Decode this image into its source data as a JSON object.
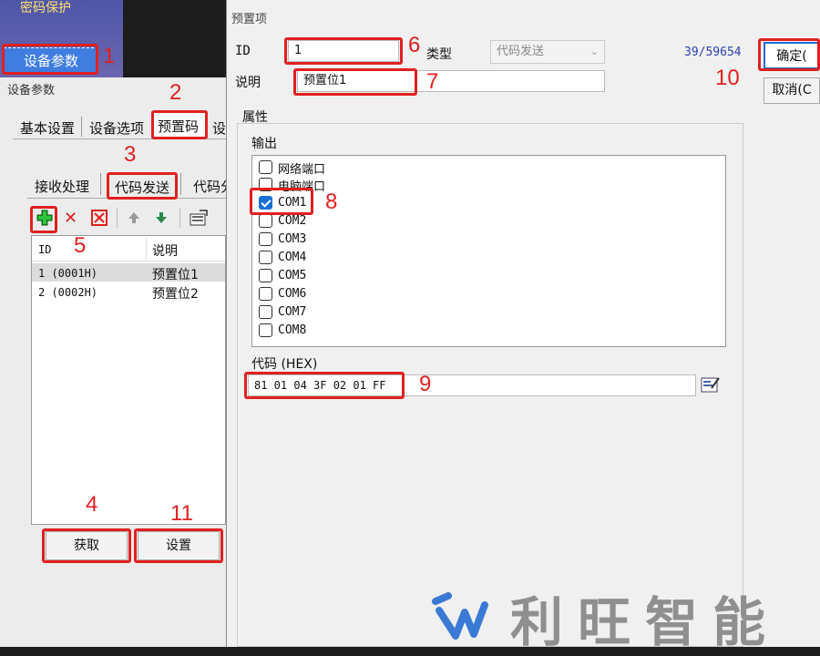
{
  "back": {
    "password_protect": "密码保护",
    "device_params_button": "设备参数",
    "window_title": "设备参数",
    "tabs": [
      "基本设置",
      "设备选项",
      "预置码",
      "设"
    ],
    "subtabs": [
      "接收处理",
      "代码发送",
      "代码分"
    ],
    "list_headers": [
      "ID",
      "说明"
    ],
    "rows": [
      {
        "id": "1 (0001H)",
        "desc": "预置位1"
      },
      {
        "id": "2 (0002H)",
        "desc": "预置位2"
      }
    ],
    "fetch_button": "获取",
    "set_button": "设置"
  },
  "dialog": {
    "title": "预置项",
    "id_label": "ID",
    "id_value": "1",
    "type_label": "类型",
    "type_value": "代码发送",
    "counter": "39/59654",
    "desc_label": "说明",
    "desc_value": "预置位1",
    "ok_button": "确定(",
    "cancel_button": "取消(C",
    "attributes_label": "属性",
    "output_label": "输出",
    "outputs": [
      {
        "label": "网络端口",
        "checked": false
      },
      {
        "label": "电脑端口",
        "checked": false
      },
      {
        "label": "COM1",
        "checked": true
      },
      {
        "label": "COM2",
        "checked": false
      },
      {
        "label": "COM3",
        "checked": false
      },
      {
        "label": "COM4",
        "checked": false
      },
      {
        "label": "COM5",
        "checked": false
      },
      {
        "label": "COM6",
        "checked": false
      },
      {
        "label": "COM7",
        "checked": false
      },
      {
        "label": "COM8",
        "checked": false
      }
    ],
    "code_label": "代码 (HEX)",
    "code_value": "81 01 04 3F 02 01 FF"
  },
  "annotations": [
    "1",
    "2",
    "3",
    "4",
    "5",
    "6",
    "7",
    "8",
    "9",
    "10",
    "11"
  ],
  "watermark": "利旺智能",
  "colors": {
    "annotation": "#e02020",
    "accent": "#1a6fd4",
    "watermark": "#8f8f8f"
  }
}
